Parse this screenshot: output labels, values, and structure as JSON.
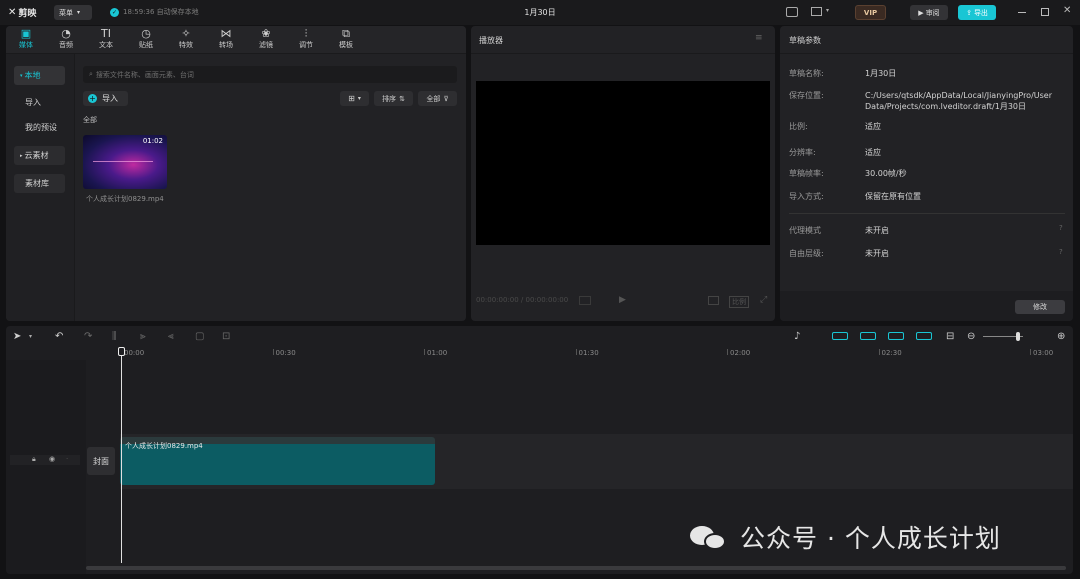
{
  "titlebar": {
    "logo": "剪映",
    "menu": "菜单",
    "autosave": "18:59:36 自动保存本地",
    "title": "1月30日",
    "vip": "VIP",
    "review_btn": "审阅",
    "export_btn": "导出"
  },
  "media_tabs": [
    {
      "label": "媒体",
      "icon": "media-icon",
      "glyph": "▣"
    },
    {
      "label": "音频",
      "icon": "audio-icon",
      "glyph": "◔"
    },
    {
      "label": "文本",
      "icon": "text-icon",
      "glyph": "TI"
    },
    {
      "label": "贴纸",
      "icon": "sticker-icon",
      "glyph": "◷"
    },
    {
      "label": "特效",
      "icon": "effects-icon",
      "glyph": "✧"
    },
    {
      "label": "转场",
      "icon": "transition-icon",
      "glyph": "⋈"
    },
    {
      "label": "滤镜",
      "icon": "filter-icon",
      "glyph": "❀"
    },
    {
      "label": "调节",
      "icon": "adjust-icon",
      "glyph": "⫶"
    },
    {
      "label": "模板",
      "icon": "template-icon",
      "glyph": "⧉"
    }
  ],
  "sidebar": {
    "items": [
      "本地",
      "导入",
      "我的预设",
      "云素材",
      "素材库"
    ]
  },
  "library": {
    "search_placeholder": "搜索文件名称、画面元素、台词",
    "import_label": "导入",
    "sort_label": "排序",
    "filter_label": "全部",
    "section_label": "全部",
    "clip": {
      "duration": "01:02",
      "filename": "个人成长计划0829.mp4"
    }
  },
  "player": {
    "title": "播放器",
    "timecode": "00:00:00:00 / 00:00:00:00",
    "ratio_label": "比例"
  },
  "draft": {
    "title": "草稿参数",
    "rows": [
      {
        "k": "草稿名称:",
        "v": "1月30日"
      },
      {
        "k": "保存位置:",
        "v": "C:/Users/qtsdk/AppData/Local/JianyingPro/User Data/Projects/com.lveditor.draft/1月30日"
      },
      {
        "k": "比例:",
        "v": "适应"
      },
      {
        "k": "分辨率:",
        "v": "适应"
      },
      {
        "k": "草稿帧率:",
        "v": "30.00帧/秒"
      },
      {
        "k": "导入方式:",
        "v": "保留在原有位置"
      },
      {
        "k": "代理模式",
        "v": "未开启"
      },
      {
        "k": "自由层级:",
        "v": "未开启"
      }
    ],
    "edit_btn": "修改"
  },
  "timeline": {
    "ticks": [
      "00:00",
      "00:30",
      "01:00",
      "01:30",
      "02:00",
      "02:30",
      "03:00"
    ],
    "cover_label": "封面",
    "clip_label": "个人成长计划0829.mp4"
  },
  "watermark": "公众号 · 个人成长计划",
  "colors": {
    "accent": "#19c6d4",
    "clip": "#0c5c63",
    "bg": "#121214",
    "panel": "#222225"
  }
}
